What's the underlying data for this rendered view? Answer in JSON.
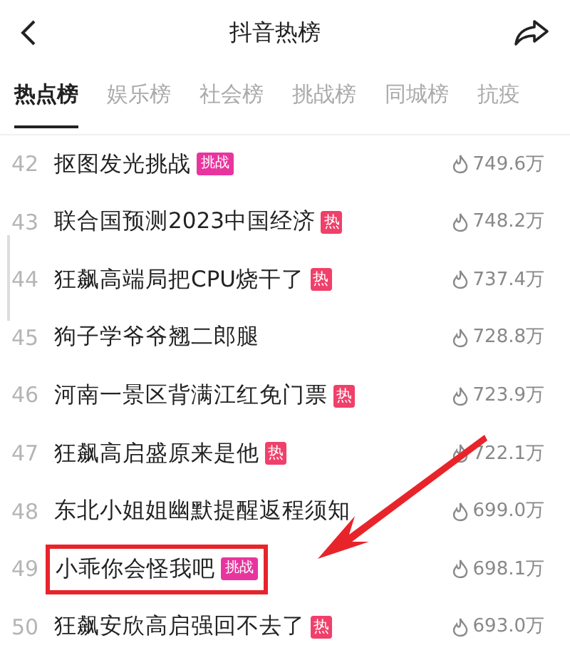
{
  "header": {
    "title": "抖音热榜"
  },
  "tabs": [
    {
      "label": "热点榜",
      "selected": true
    },
    {
      "label": "娱乐榜",
      "selected": false
    },
    {
      "label": "社会榜",
      "selected": false
    },
    {
      "label": "挑战榜",
      "selected": false
    },
    {
      "label": "同城榜",
      "selected": false
    },
    {
      "label": "抗疫",
      "selected": false
    }
  ],
  "rows": [
    {
      "rank": "42",
      "title": "抠图发光挑战",
      "tag": {
        "kind": "challenge",
        "label": "挑战"
      },
      "heat": "749.6万",
      "highlighted": false
    },
    {
      "rank": "43",
      "title": "联合国预测2023中国经济",
      "tag": {
        "kind": "hot",
        "label": "热"
      },
      "heat": "748.2万",
      "highlighted": false
    },
    {
      "rank": "44",
      "title": "狂飙高端局把CPU烧干了",
      "tag": {
        "kind": "hot",
        "label": "热"
      },
      "heat": "737.4万",
      "highlighted": false
    },
    {
      "rank": "45",
      "title": "狗子学爷爷翘二郎腿",
      "heat": "728.8万",
      "highlighted": false
    },
    {
      "rank": "46",
      "title": "河南一景区背满江红免门票",
      "tag": {
        "kind": "hot",
        "label": "热"
      },
      "heat": "723.9万",
      "highlighted": false
    },
    {
      "rank": "47",
      "title": "狂飙高启盛原来是他",
      "tag": {
        "kind": "hot",
        "label": "热"
      },
      "heat": "722.1万",
      "highlighted": false
    },
    {
      "rank": "48",
      "title": "东北小姐姐幽默提醒返程须知",
      "heat": "699.0万",
      "highlighted": false
    },
    {
      "rank": "49",
      "title": "小乖你会怪我吧",
      "tag": {
        "kind": "challenge",
        "label": "挑战"
      },
      "heat": "698.1万",
      "highlighted": true
    },
    {
      "rank": "50",
      "title": "狂飙安欣高启强回不去了",
      "tag": {
        "kind": "hot",
        "label": "热"
      },
      "heat": "693.0万",
      "highlighted": false
    }
  ]
}
